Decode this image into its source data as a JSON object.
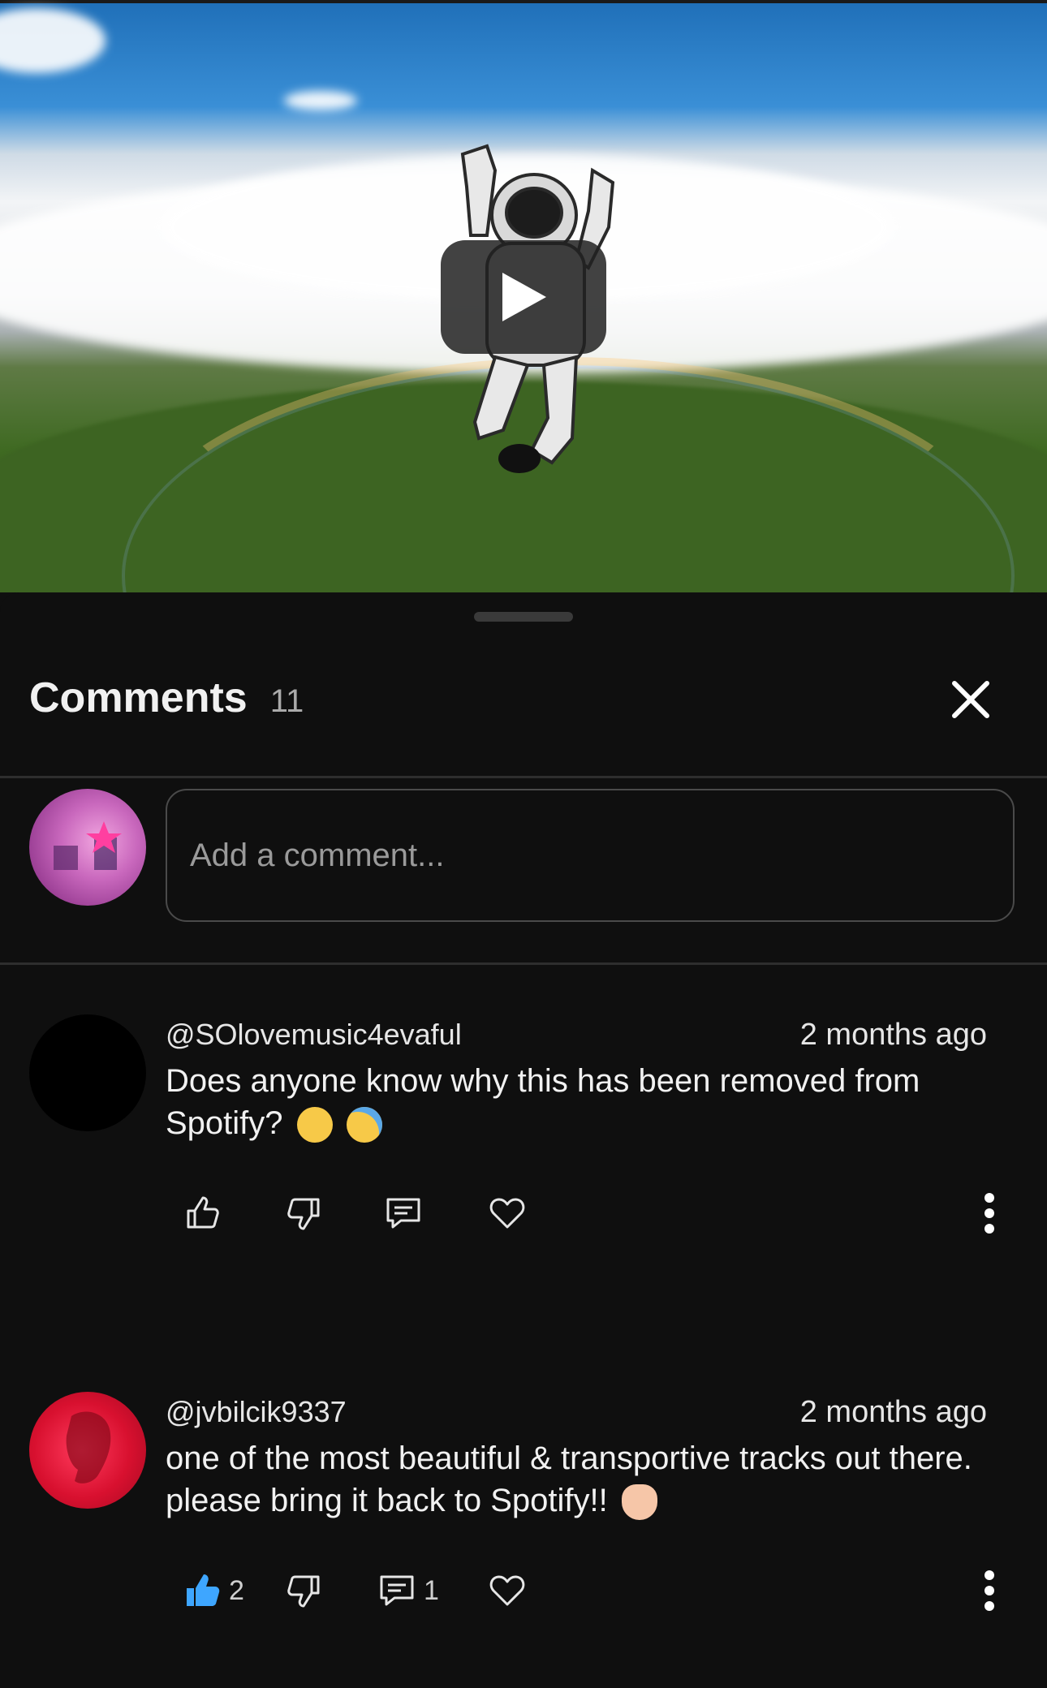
{
  "video": {
    "icons": {
      "play": "play-icon"
    }
  },
  "comments_panel": {
    "title": "Comments",
    "count": "11",
    "icons": {
      "close": "close-icon"
    },
    "input": {
      "placeholder": "Add a comment..."
    }
  },
  "comments": [
    {
      "author": "@SOlovemusic4evaful",
      "time": "2 months ago",
      "text": "Does anyone know why this has been removed from Spotify?",
      "emojis": [
        "pleading-face",
        "crying-face"
      ],
      "likes": "",
      "replies": ""
    },
    {
      "author": "@jvbilcik9337",
      "time": "2 months ago",
      "text": "one of the most beautiful & transportive tracks out there. please bring it back to Spotify!!",
      "emojis": [
        "heart-hands"
      ],
      "likes": "2",
      "liked": true,
      "replies": "1"
    }
  ],
  "colors": {
    "background": "#0f0f0f",
    "text": "#f1f1f1",
    "muted": "#aaaaaa",
    "liked_blue": "#3ea6ff",
    "avatar_red": "#d8102f"
  }
}
